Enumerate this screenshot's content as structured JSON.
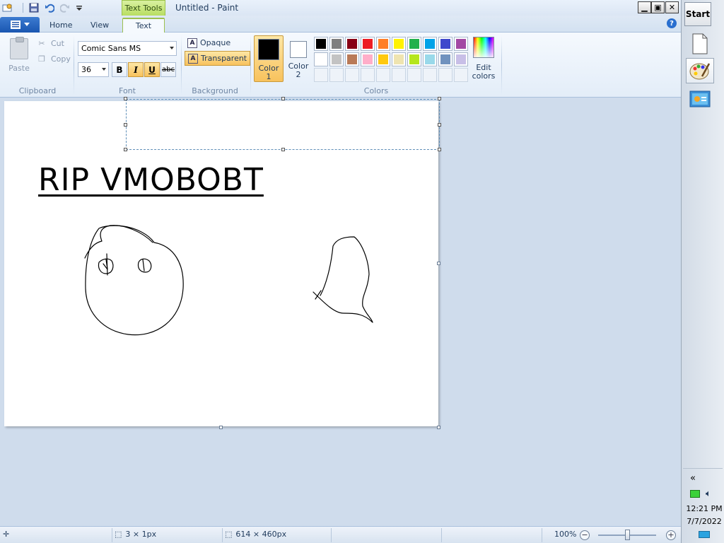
{
  "window": {
    "title": "Untitled - Paint",
    "context_tab_group": "Text Tools"
  },
  "title_buttons": {
    "minimize": "▁",
    "maximize": "▣",
    "close": "✕"
  },
  "tabs": [
    {
      "label": "Home",
      "active": false
    },
    {
      "label": "View",
      "active": false
    },
    {
      "label": "Text",
      "active": true
    }
  ],
  "ribbon": {
    "clipboard": {
      "paste": "Paste",
      "cut": "Cut",
      "copy": "Copy",
      "group_label": "Clipboard"
    },
    "font": {
      "family": "Comic Sans MS",
      "size": "36",
      "bold": "B",
      "italic": "I",
      "underline": "U",
      "strikethrough": "abc",
      "italic_on": true,
      "underline_on": true,
      "group_label": "Font"
    },
    "background": {
      "opaque": "Opaque",
      "transparent": "Transparent",
      "selected": "transparent",
      "group_label": "Background"
    },
    "colors": {
      "color1_label": "Color\n1",
      "color1_value": "#000000",
      "color2_label": "Color\n2",
      "color2_value": "#ffffff",
      "group_label": "Colors",
      "edit_colors": "Edit\ncolors",
      "palette_row1": [
        "#000000",
        "#7f7f7f",
        "#880015",
        "#ed1c24",
        "#ff7f27",
        "#fff200",
        "#22b14c",
        "#00a2e8",
        "#3f48cc",
        "#a349a4"
      ],
      "palette_row2": [
        "#ffffff",
        "#c3c3c3",
        "#b97a57",
        "#ffaec9",
        "#ffc90e",
        "#efe4b0",
        "#b5e61d",
        "#99d9ea",
        "#7092be",
        "#c8bfe7"
      ]
    }
  },
  "canvas": {
    "text": "RIP VMOBOBT",
    "text_color": "#000000",
    "background": "#ffffff"
  },
  "statusbar": {
    "selection_size": "3 × 1px",
    "canvas_size": "614 × 460px",
    "zoom": "100%"
  },
  "sidepanel": {
    "start": "Start",
    "collapse": "«",
    "time": "12:21 PM",
    "date": "7/7/2022"
  }
}
